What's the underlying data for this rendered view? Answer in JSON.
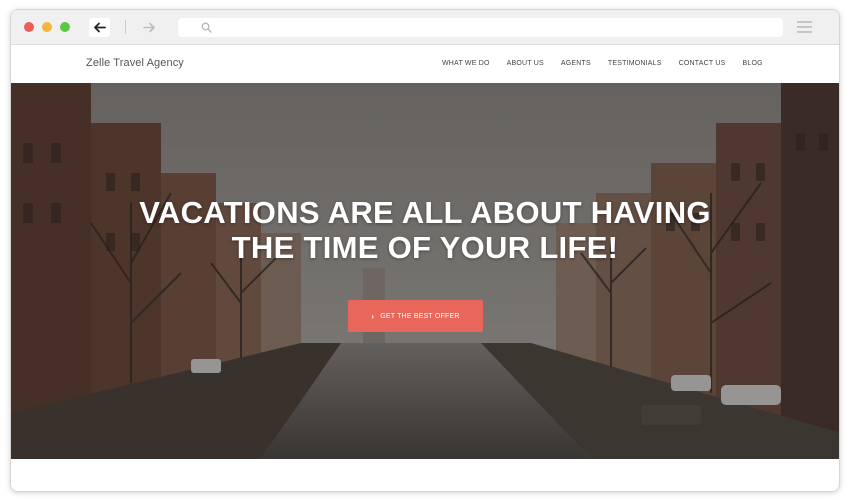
{
  "browser": {
    "back_icon": "arrow-left-icon",
    "forward_icon": "arrow-right-icon",
    "search_icon": "search-icon",
    "menu_icon": "hamburger-icon",
    "url_value": ""
  },
  "site": {
    "brand": "Zelle Travel Agency",
    "nav": [
      {
        "label": "WHAT WE DO"
      },
      {
        "label": "ABOUT US"
      },
      {
        "label": "AGENTS"
      },
      {
        "label": "TESTIMONIALS"
      },
      {
        "label": "CONTACT US"
      },
      {
        "label": "BLOG"
      }
    ]
  },
  "hero": {
    "headline_line1": "VACATIONS ARE ALL ABOUT HAVING",
    "headline_line2": "THE TIME OF YOUR LIFE!",
    "cta_label": "GET THE BEST OFFER",
    "cta_icon": "chevron-right-icon"
  },
  "colors": {
    "accent": "#e8665a",
    "dot_red": "#ed5c55",
    "dot_yellow": "#f4b43e",
    "dot_green": "#5dc747"
  }
}
